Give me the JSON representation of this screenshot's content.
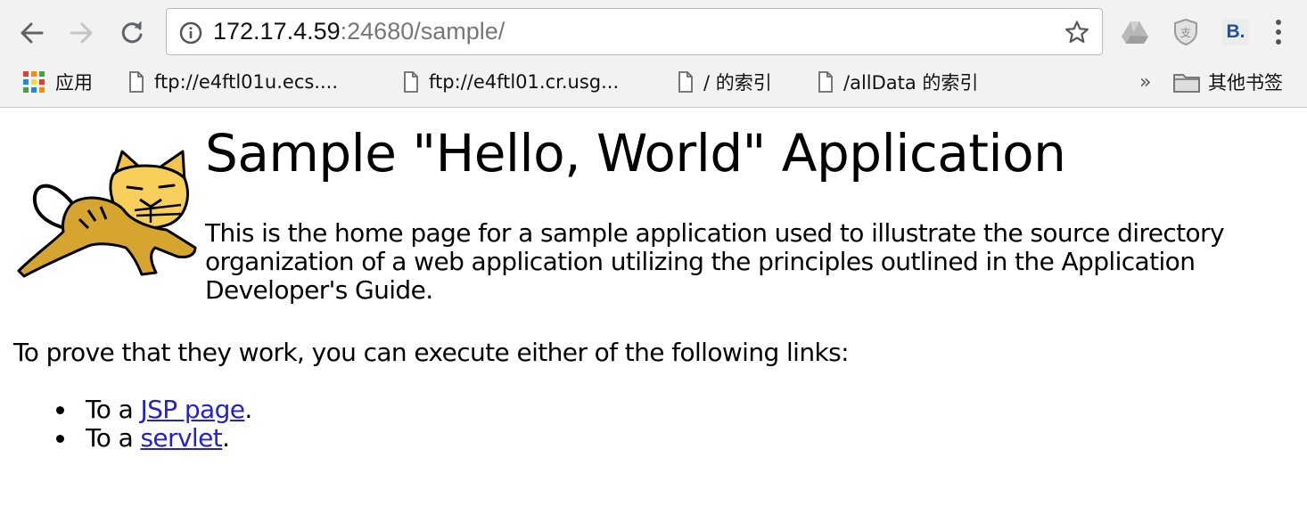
{
  "browser": {
    "url_host": "172.17.4.59",
    "url_rest": ":24680/sample/",
    "bookmarks": {
      "apps_label": "应用",
      "items": [
        {
          "label": "ftp://e4ftl01u.ecs...."
        },
        {
          "label": "ftp://e4ftl01.cr.usg..."
        },
        {
          "label": "/ 的索引"
        },
        {
          "label": "/allData 的索引"
        }
      ],
      "more_label": "»",
      "other_label": "其他书签"
    },
    "extensions": {
      "b_label": "B."
    }
  },
  "page": {
    "title": "Sample \"Hello, World\" Application",
    "intro": "This is the home page for a sample application used to illustrate the source directory organization of a web application utilizing the principles outlined in the Application Developer's Guide.",
    "prove": "To prove that they work, you can execute either of the following links:",
    "links": [
      {
        "prefix": "To a ",
        "link_text": "JSP page",
        "suffix": "."
      },
      {
        "prefix": "To a ",
        "link_text": "servlet",
        "suffix": "."
      }
    ]
  },
  "colors": {
    "link": "#2323c8",
    "chrome_bg": "#f2f2f2"
  }
}
